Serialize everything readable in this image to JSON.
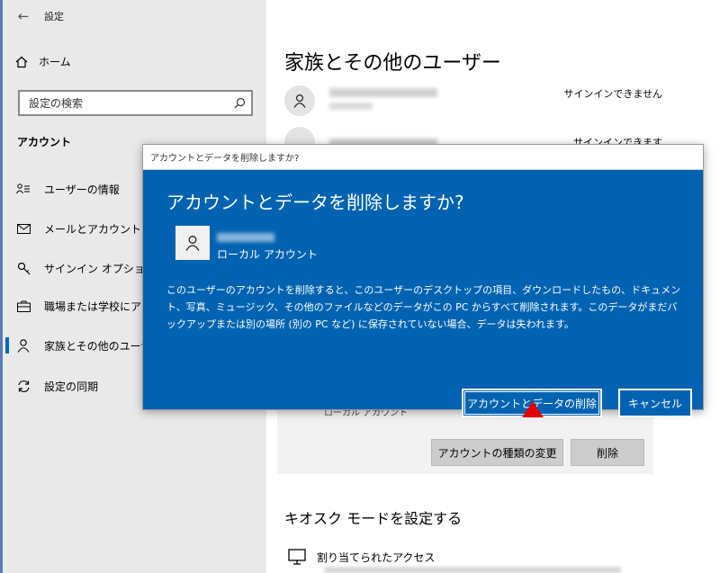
{
  "app": {
    "title": "設定",
    "back_glyph": "←"
  },
  "sidebar": {
    "home": "ホーム",
    "search_placeholder": "設定の検索",
    "section": "アカウント",
    "items": [
      {
        "label": "ユーザーの情報",
        "icon": "user-info-icon"
      },
      {
        "label": "メールとアカウント",
        "icon": "mail-icon"
      },
      {
        "label": "サインイン オプション",
        "icon": "key-icon"
      },
      {
        "label": "職場または学校にアクセス",
        "icon": "briefcase-icon"
      },
      {
        "label": "家族とその他のユーザー",
        "icon": "person-icon",
        "active": true
      },
      {
        "label": "設定の同期",
        "icon": "sync-icon"
      }
    ]
  },
  "main": {
    "title": "家族とその他のユーザー",
    "users": [
      {
        "status": "サインインできません"
      },
      {
        "status": "サインインできます"
      }
    ],
    "selected_user": {
      "account_type": "ローカル アカウント"
    },
    "change_type_button": "アカウントの種類の変更",
    "delete_button": "削除",
    "kiosk_heading": "キオスク モードを設定する",
    "assigned_access": "割り当てられたアクセス"
  },
  "dialog": {
    "window_title": "アカウントとデータを削除しますか?",
    "heading": "アカウントとデータを削除しますか?",
    "account_type": "ローカル アカウント",
    "message": "このユーザーのアカウントを削除すると、このユーザーのデスクトップの項目、ダウンロードしたもの、ドキュメント、写真、ミュージック、その他のファイルなどのデータがこの PC からすべて削除されます。このデータがまだバックアップまたは別の場所 (別の PC など) に保存されていない場合、データは失われます。",
    "confirm_button": "アカウントとデータの削除",
    "cancel_button": "キャンセル"
  },
  "colors": {
    "dialog_blue": "#0063b1",
    "annotation_red": "#e00000",
    "accent": "#0067c0"
  }
}
